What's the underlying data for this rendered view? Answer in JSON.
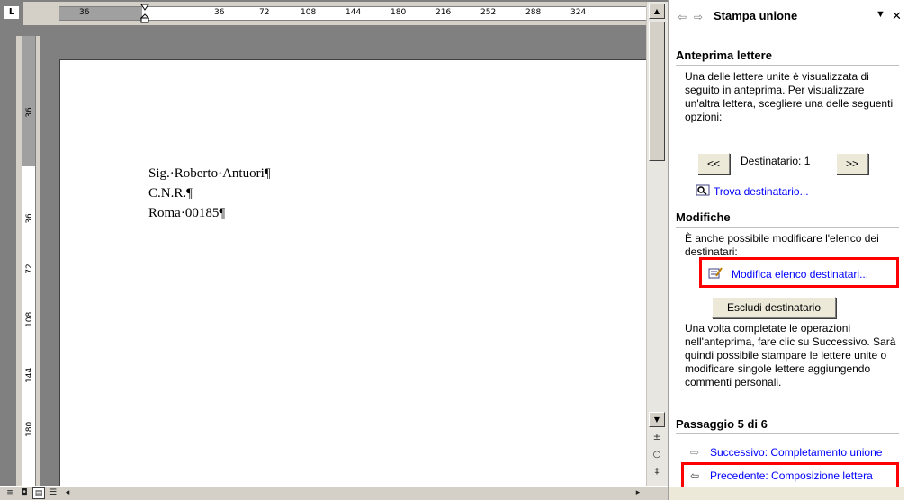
{
  "ruler": {
    "corner_label": "L",
    "h_labels": [
      "36",
      "36",
      "72",
      "108",
      "144",
      "180",
      "216",
      "252",
      "288",
      "324"
    ],
    "v_labels": [
      "36",
      "36",
      "72",
      "108",
      "144",
      "180"
    ]
  },
  "document": {
    "lines": [
      "Sig.·Roberto·Antuori¶",
      "C.N.R.¶",
      "Roma·00185¶"
    ]
  },
  "taskpane": {
    "title": "Stampa unione",
    "preview": {
      "heading": "Anteprima lettere",
      "description": "Una delle lettere unite è visualizzata di seguito in anteprima. Per visualizzare un'altra lettera, scegliere una delle seguenti opzioni:",
      "prev_label": "<<",
      "next_label": ">>",
      "recipient_label": "Destinatario: 1",
      "find_link": "Trova destinatario..."
    },
    "changes": {
      "heading": "Modifiche",
      "description": "È anche possibile modificare l'elenco dei destinatari:",
      "edit_link": "Modifica elenco destinatari...",
      "exclude_button": "Escludi destinatario",
      "note": "Una volta completate le operazioni nell'anteprima, fare clic su Successivo. Sarà quindi possibile stampare le lettere unite o modificare singole lettere aggiungendo commenti personali."
    },
    "step": {
      "heading": "Passaggio 5 di 6",
      "next_link": "Successivo: Completamento unione",
      "prev_link": "Precedente: Composizione lettera"
    }
  },
  "colors": {
    "highlight": "#ff0000",
    "link": "#0000ff"
  }
}
